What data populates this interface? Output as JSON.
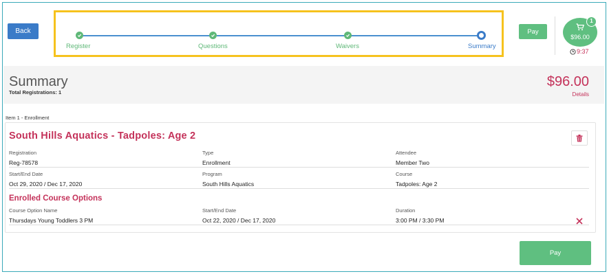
{
  "header": {
    "back_label": "Back",
    "pay_label": "Pay",
    "cart_amount": "$96.00",
    "cart_count": "1",
    "timer": "9:37"
  },
  "stepper": {
    "steps": [
      {
        "label": "Register",
        "state": "complete"
      },
      {
        "label": "Questions",
        "state": "complete"
      },
      {
        "label": "Waivers",
        "state": "complete"
      },
      {
        "label": "Summary",
        "state": "current"
      }
    ]
  },
  "summary": {
    "title": "Summary",
    "total_registrations": "Total Registrations: 1",
    "total_amount": "$96.00",
    "details_label": "Details"
  },
  "item": {
    "label": "Item 1 - Enrollment",
    "title": "South Hills Aquatics - Tadpoles: Age 2",
    "fields": {
      "registration_label": "Registration",
      "registration_value": "Reg-78578",
      "type_label": "Type",
      "type_value": "Enrollment",
      "attendee_label": "Attendee",
      "attendee_value": "Member Two",
      "dates_label": "Start/End Date",
      "dates_value": "Oct 29, 2020 / Dec 17, 2020",
      "program_label": "Program",
      "program_value": "South Hills Aquatics",
      "course_label": "Course",
      "course_value": "Tadpoles: Age 2"
    },
    "options": {
      "title": "Enrolled Course Options",
      "name_label": "Course Option Name",
      "name_value": "Thursdays Young Toddlers 3 PM",
      "dates_label": "Start/End Date",
      "dates_value": "Oct 22, 2020 / Dec 17, 2020",
      "duration_label": "Duration",
      "duration_value": "3:00 PM / 3:30 PM"
    }
  },
  "footer": {
    "pay_label": "Pay"
  },
  "colors": {
    "accent_green": "#5fbf80",
    "accent_blue": "#3a7bc8",
    "accent_pink": "#c4325a",
    "highlight_yellow": "#f6c21d"
  }
}
